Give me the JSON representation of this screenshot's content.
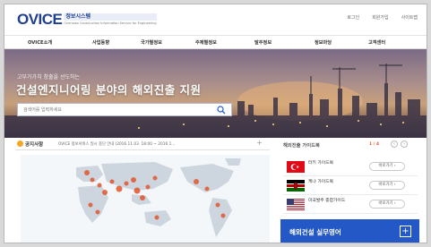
{
  "header": {
    "logo_mark": "OVICE",
    "logo_korean": "정보시스템",
    "logo_english": "Overseas Construction Information Service for Engineering",
    "util_links": [
      "로그인",
      "회원가입",
      "사이트맵"
    ]
  },
  "gnb": {
    "items": [
      "OVICE소개",
      "사업동향",
      "국가별정보",
      "주제별정보",
      "발주정보",
      "정보마당",
      "고객센터"
    ]
  },
  "hero": {
    "subtitle": "고부가가치 창출을 선도하는",
    "title": "건설엔지니어링 분야의 해외진출 지원",
    "search_placeholder": "검색어를 입력하세요"
  },
  "notice": {
    "label": "공지사항",
    "text": "OVICE 정보서비스 일시 중단 안내 (2016.11.03. 18:00 ~ 2016.1...",
    "more": "+"
  },
  "guide": {
    "title": "해외진출 가이드북",
    "page": "1 / 4",
    "prev": "‹",
    "next": "›",
    "items": [
      {
        "name": "터키 가이드북",
        "button": "바로가기 ›"
      },
      {
        "name": "케냐 가이드북",
        "button": "바로가기 ›"
      },
      {
        "name": "미국발주 종합가이드",
        "button": "바로가기 ›"
      }
    ]
  },
  "banner": {
    "text": "해외건설 실무영어",
    "plus": "+"
  },
  "colors": {
    "brand": "#1f3f8f",
    "banner": "#2458c6",
    "notice_icon": "#f5a623",
    "map_marker": "#e2572e"
  }
}
